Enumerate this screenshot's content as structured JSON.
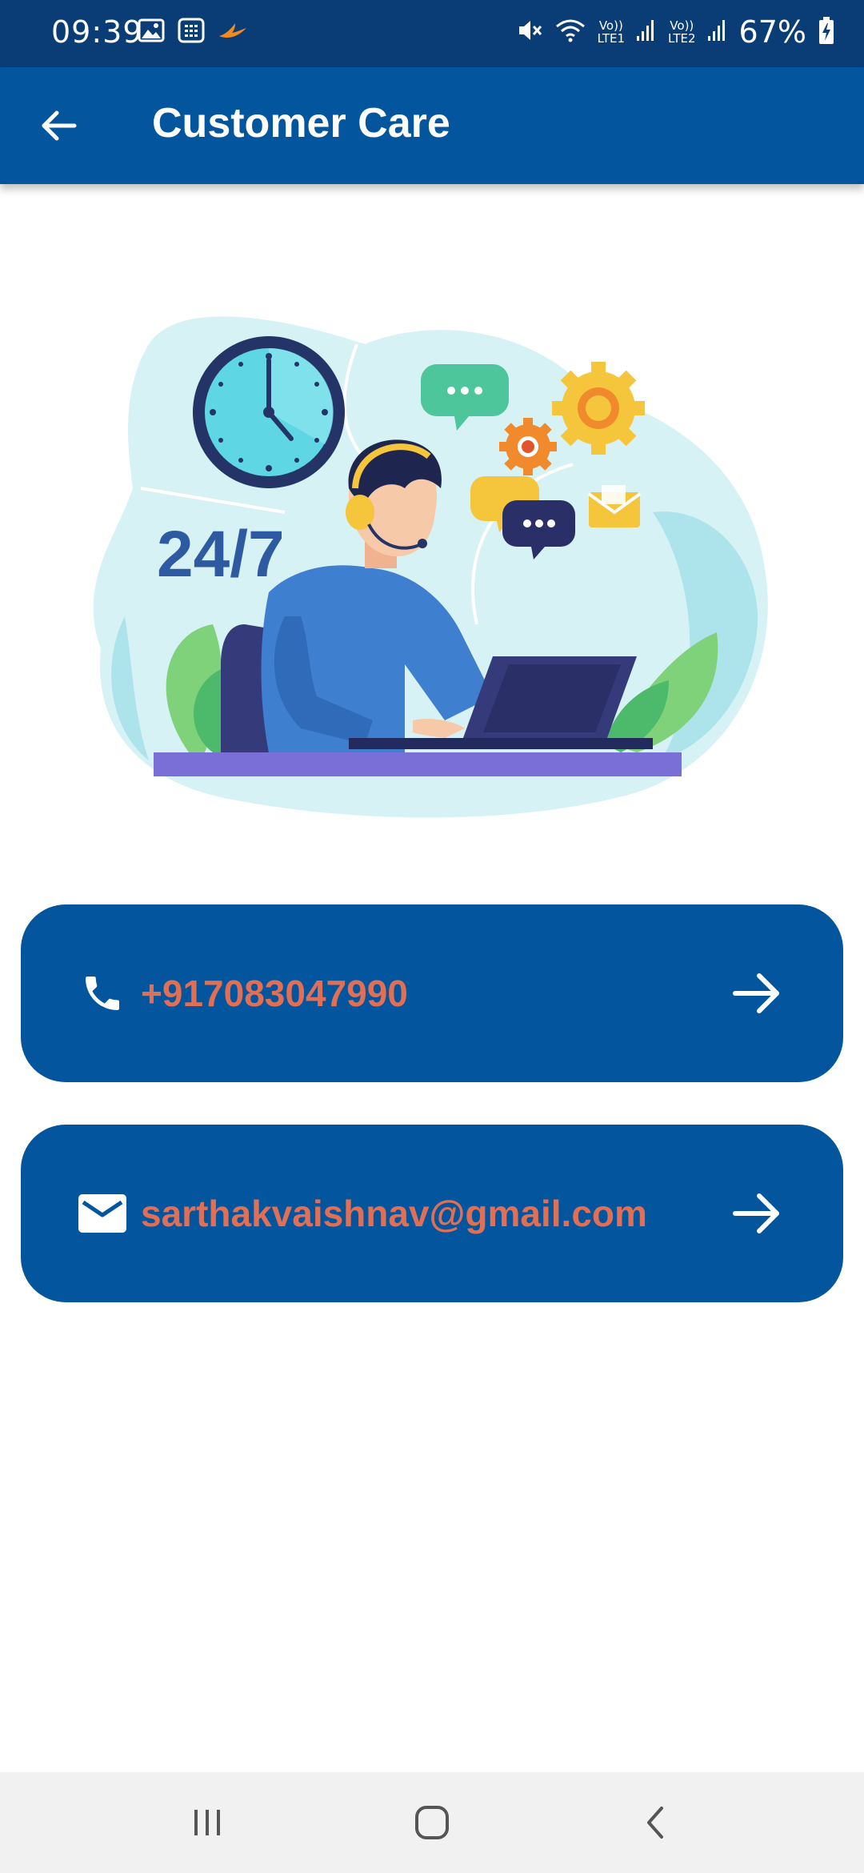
{
  "status_bar": {
    "time": "09:39",
    "battery": "67%",
    "lte1": "LTE1",
    "lte2": "LTE2",
    "volte": "Vo))",
    "icons": [
      "gallery-icon",
      "calculator-icon",
      "bird-app-icon",
      "mute-icon",
      "wifi-icon",
      "signal-icon",
      "battery-charging-icon"
    ]
  },
  "header": {
    "title": "Customer Care",
    "back_icon": "arrow-left-icon"
  },
  "illustration": {
    "badge_text": "24/7"
  },
  "contacts": {
    "phone": {
      "icon": "phone-icon",
      "value": "+917083047990",
      "arrow_icon": "arrow-right-icon"
    },
    "email": {
      "icon": "mail-icon",
      "value": "sarthakvaishnav@gmail.com",
      "arrow_icon": "arrow-right-icon"
    }
  },
  "colors": {
    "status_bar": "#0a3d75",
    "app_bar": "#03569e",
    "card": "#03569e",
    "card_text": "#e06f55",
    "nav_bar": "#f1f1f1"
  },
  "nav_bar": {
    "buttons": [
      "recent-apps-icon",
      "home-icon",
      "back-icon"
    ]
  }
}
